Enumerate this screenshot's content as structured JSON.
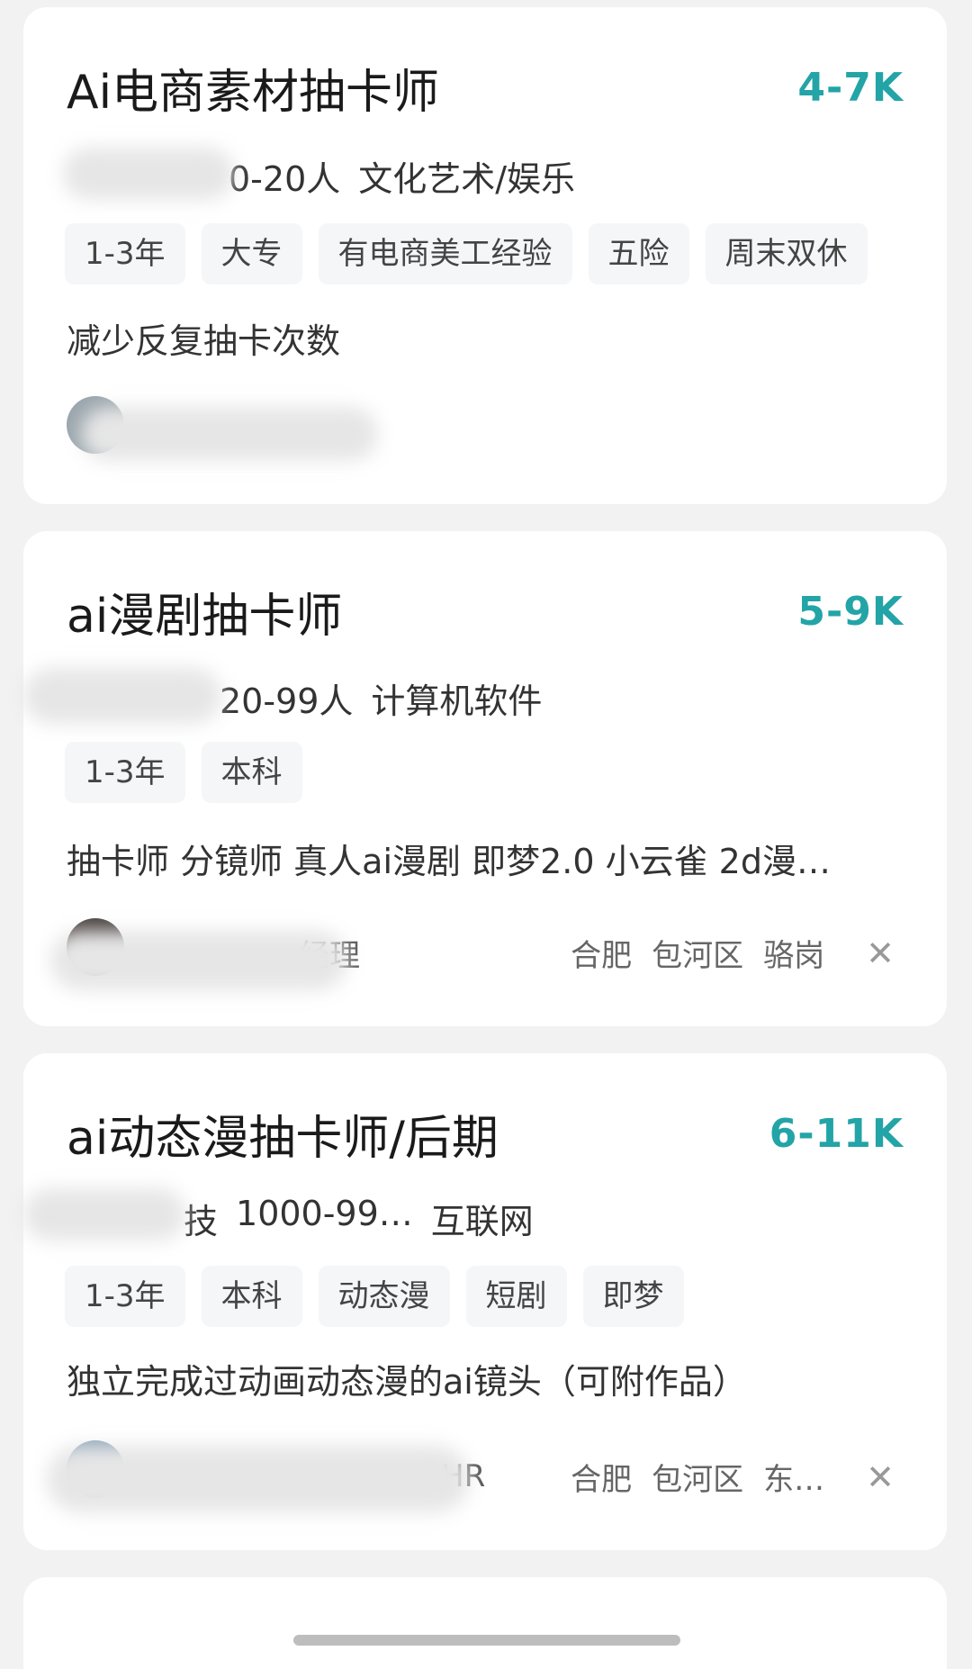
{
  "jobs": [
    {
      "title": "Ai电商素材抽卡师",
      "salary": "4-7K",
      "company": {
        "size": "0-20人",
        "industry": "文化艺术/娱乐"
      },
      "tags": [
        "1-3年",
        "大专",
        "有电商美工经验",
        "五险",
        "周末双休"
      ],
      "desc": "减少反复抽卡次数"
    },
    {
      "title": "ai漫剧抽卡师",
      "salary": "5-9K",
      "company": {
        "size": "20-99人",
        "industry": "计算机软件"
      },
      "tags": [
        "1-3年",
        "本科"
      ],
      "desc": "抽卡师 分镜师 真人ai漫剧 即梦2.0 小云雀 2d漫…",
      "recruiter_fragment": "经理",
      "location": {
        "city": "合肥",
        "district": "包河区",
        "area": "骆岗"
      }
    },
    {
      "title": "ai动态漫抽卡师/后期",
      "salary": "6-11K",
      "company": {
        "name_fragment": "技",
        "size": "1000-99…",
        "industry": "互联网"
      },
      "tags": [
        "1-3年",
        "本科",
        "动态漫",
        "短剧",
        "即梦"
      ],
      "desc": "独立完成过动画动态漫的ai镜头（可附作品）",
      "recruiter_fragment": "HR",
      "location": {
        "city": "合肥",
        "district": "包河区",
        "area": "东…"
      }
    }
  ],
  "close_glyph": "✕",
  "colors": {
    "salary": "#23a4a7",
    "background": "#f2f2f2"
  }
}
